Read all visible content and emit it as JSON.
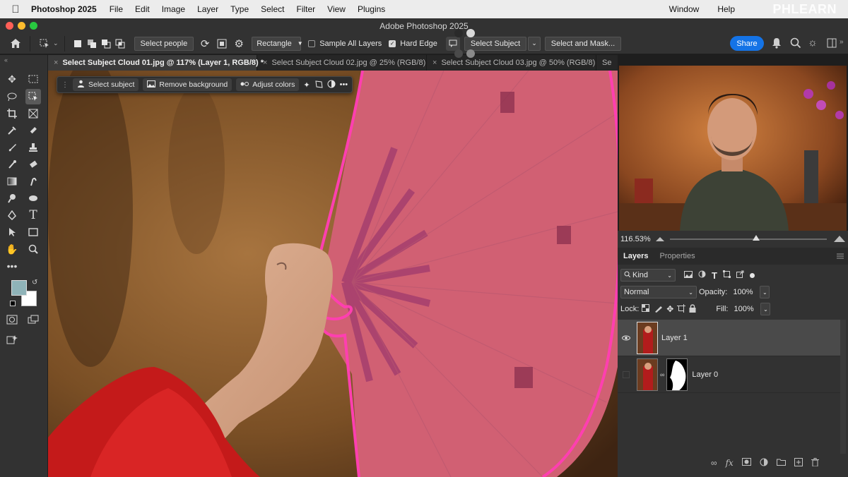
{
  "menubar": {
    "app_name": "Photoshop 2025",
    "items": [
      "File",
      "Edit",
      "Image",
      "Layer",
      "Type",
      "Select",
      "Filter",
      "View",
      "Plugins"
    ],
    "right_items": [
      "Window",
      "Help"
    ],
    "watermark": "PHLEARN"
  },
  "window": {
    "title": "Adobe Photoshop 2025"
  },
  "options_bar": {
    "select_people": "Select people",
    "mode": "Rectangle",
    "sample_all_layers": {
      "label": "Sample All Layers",
      "checked": false
    },
    "hard_edge": {
      "label": "Hard Edge",
      "checked": true
    },
    "select_subject": "Select Subject",
    "select_and_mask": "Select and Mask...",
    "share": "Share"
  },
  "tabs": [
    {
      "label": "Select Subject Cloud 01.jpg @ 117% (Layer 1, RGB/8) *",
      "active": true
    },
    {
      "label": "Select Subject Cloud 02.jpg @ 25% (RGB/8)",
      "active": false
    },
    {
      "label": "Select Subject Cloud 03.jpg @ 50% (RGB/8)",
      "active": false
    },
    {
      "label": "Se",
      "active": false
    }
  ],
  "context_bar": {
    "select_subject": "Select subject",
    "remove_background": "Remove background",
    "adjust_colors": "Adjust colors"
  },
  "navigator": {
    "zoom": "116.53%"
  },
  "panel_tabs": {
    "layers": "Layers",
    "properties": "Properties"
  },
  "layers_panel": {
    "filter_kind": "Kind",
    "blend_mode": "Normal",
    "opacity_label": "Opacity:",
    "opacity": "100%",
    "lock_label": "Lock:",
    "fill_label": "Fill:",
    "fill": "100%",
    "layers": [
      {
        "name": "Layer 1",
        "visible": true,
        "active": true
      },
      {
        "name": "Layer 0",
        "visible": false,
        "active": false
      }
    ]
  },
  "colors": {
    "accent": "#1473e6",
    "selection_overlay": "#e0308c",
    "foreground": "#8fb3b8",
    "background": "#ffffff"
  }
}
